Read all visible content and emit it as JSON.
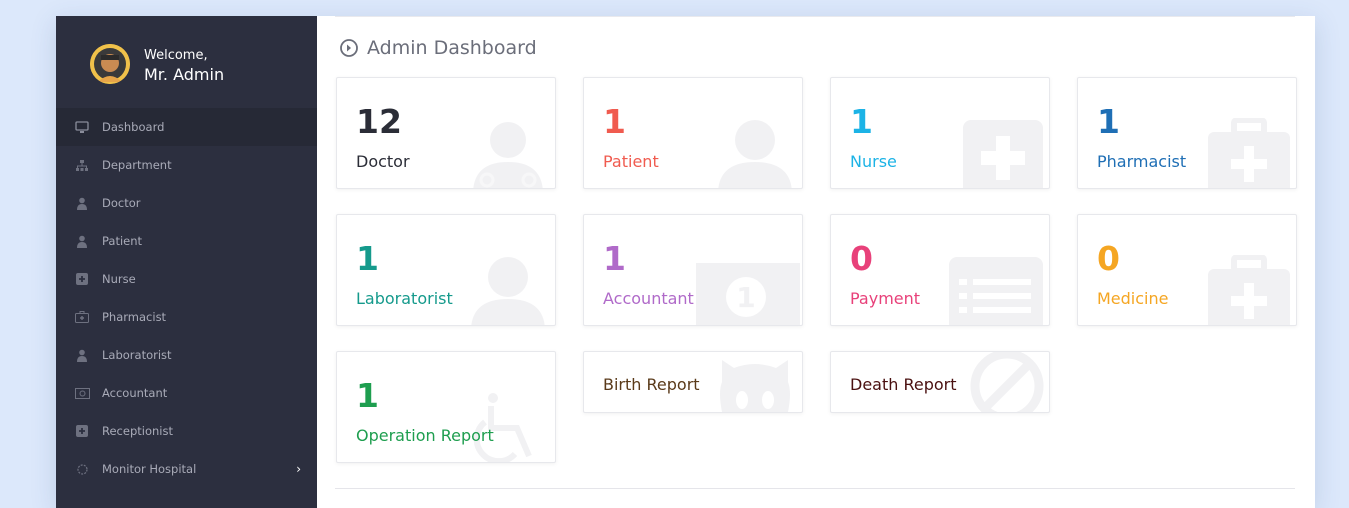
{
  "profile": {
    "welcome": "Welcome,",
    "name": "Mr. Admin"
  },
  "sidebar": {
    "items": [
      {
        "label": "Dashboard",
        "icon": "monitor-icon"
      },
      {
        "label": "Department",
        "icon": "sitemap-icon"
      },
      {
        "label": "Doctor",
        "icon": "user-md-icon"
      },
      {
        "label": "Patient",
        "icon": "user-icon"
      },
      {
        "label": "Nurse",
        "icon": "plus-square-icon"
      },
      {
        "label": "Pharmacist",
        "icon": "medkit-icon"
      },
      {
        "label": "Laboratorist",
        "icon": "user-icon"
      },
      {
        "label": "Accountant",
        "icon": "money-icon"
      },
      {
        "label": "Receptionist",
        "icon": "plus-square-icon"
      },
      {
        "label": "Monitor Hospital",
        "icon": "gear-icon",
        "chevron": "›"
      }
    ]
  },
  "main": {
    "title": "Admin Dashboard",
    "cards": [
      {
        "value": "12",
        "label": "Doctor",
        "color": "#2b2d37",
        "icon": "user-md-icon"
      },
      {
        "value": "1",
        "label": "Patient",
        "color": "#f05b4f",
        "icon": "user-icon"
      },
      {
        "value": "1",
        "label": "Nurse",
        "color": "#1cb3e6",
        "icon": "plus-square-icon"
      },
      {
        "value": "1",
        "label": "Pharmacist",
        "color": "#1f6fb5",
        "icon": "medkit-icon"
      },
      {
        "value": "1",
        "label": "Laboratorist",
        "color": "#159a8c",
        "icon": "user-icon"
      },
      {
        "value": "1",
        "label": "Accountant",
        "color": "#b06ac9",
        "icon": "money-icon"
      },
      {
        "value": "0",
        "label": "Payment",
        "color": "#e8417a",
        "icon": "list-alt-icon"
      },
      {
        "value": "0",
        "label": "Medicine",
        "color": "#f5a623",
        "icon": "medkit-icon"
      },
      {
        "value": "1",
        "label": "Operation Report",
        "color": "#1e9e4f",
        "icon": "wheelchair-icon"
      },
      {
        "label": "Birth Report",
        "color": "#5a3a1a",
        "icon": "github-icon"
      },
      {
        "label": "Death Report",
        "color": "#4a1010",
        "icon": "ban-icon"
      }
    ]
  }
}
